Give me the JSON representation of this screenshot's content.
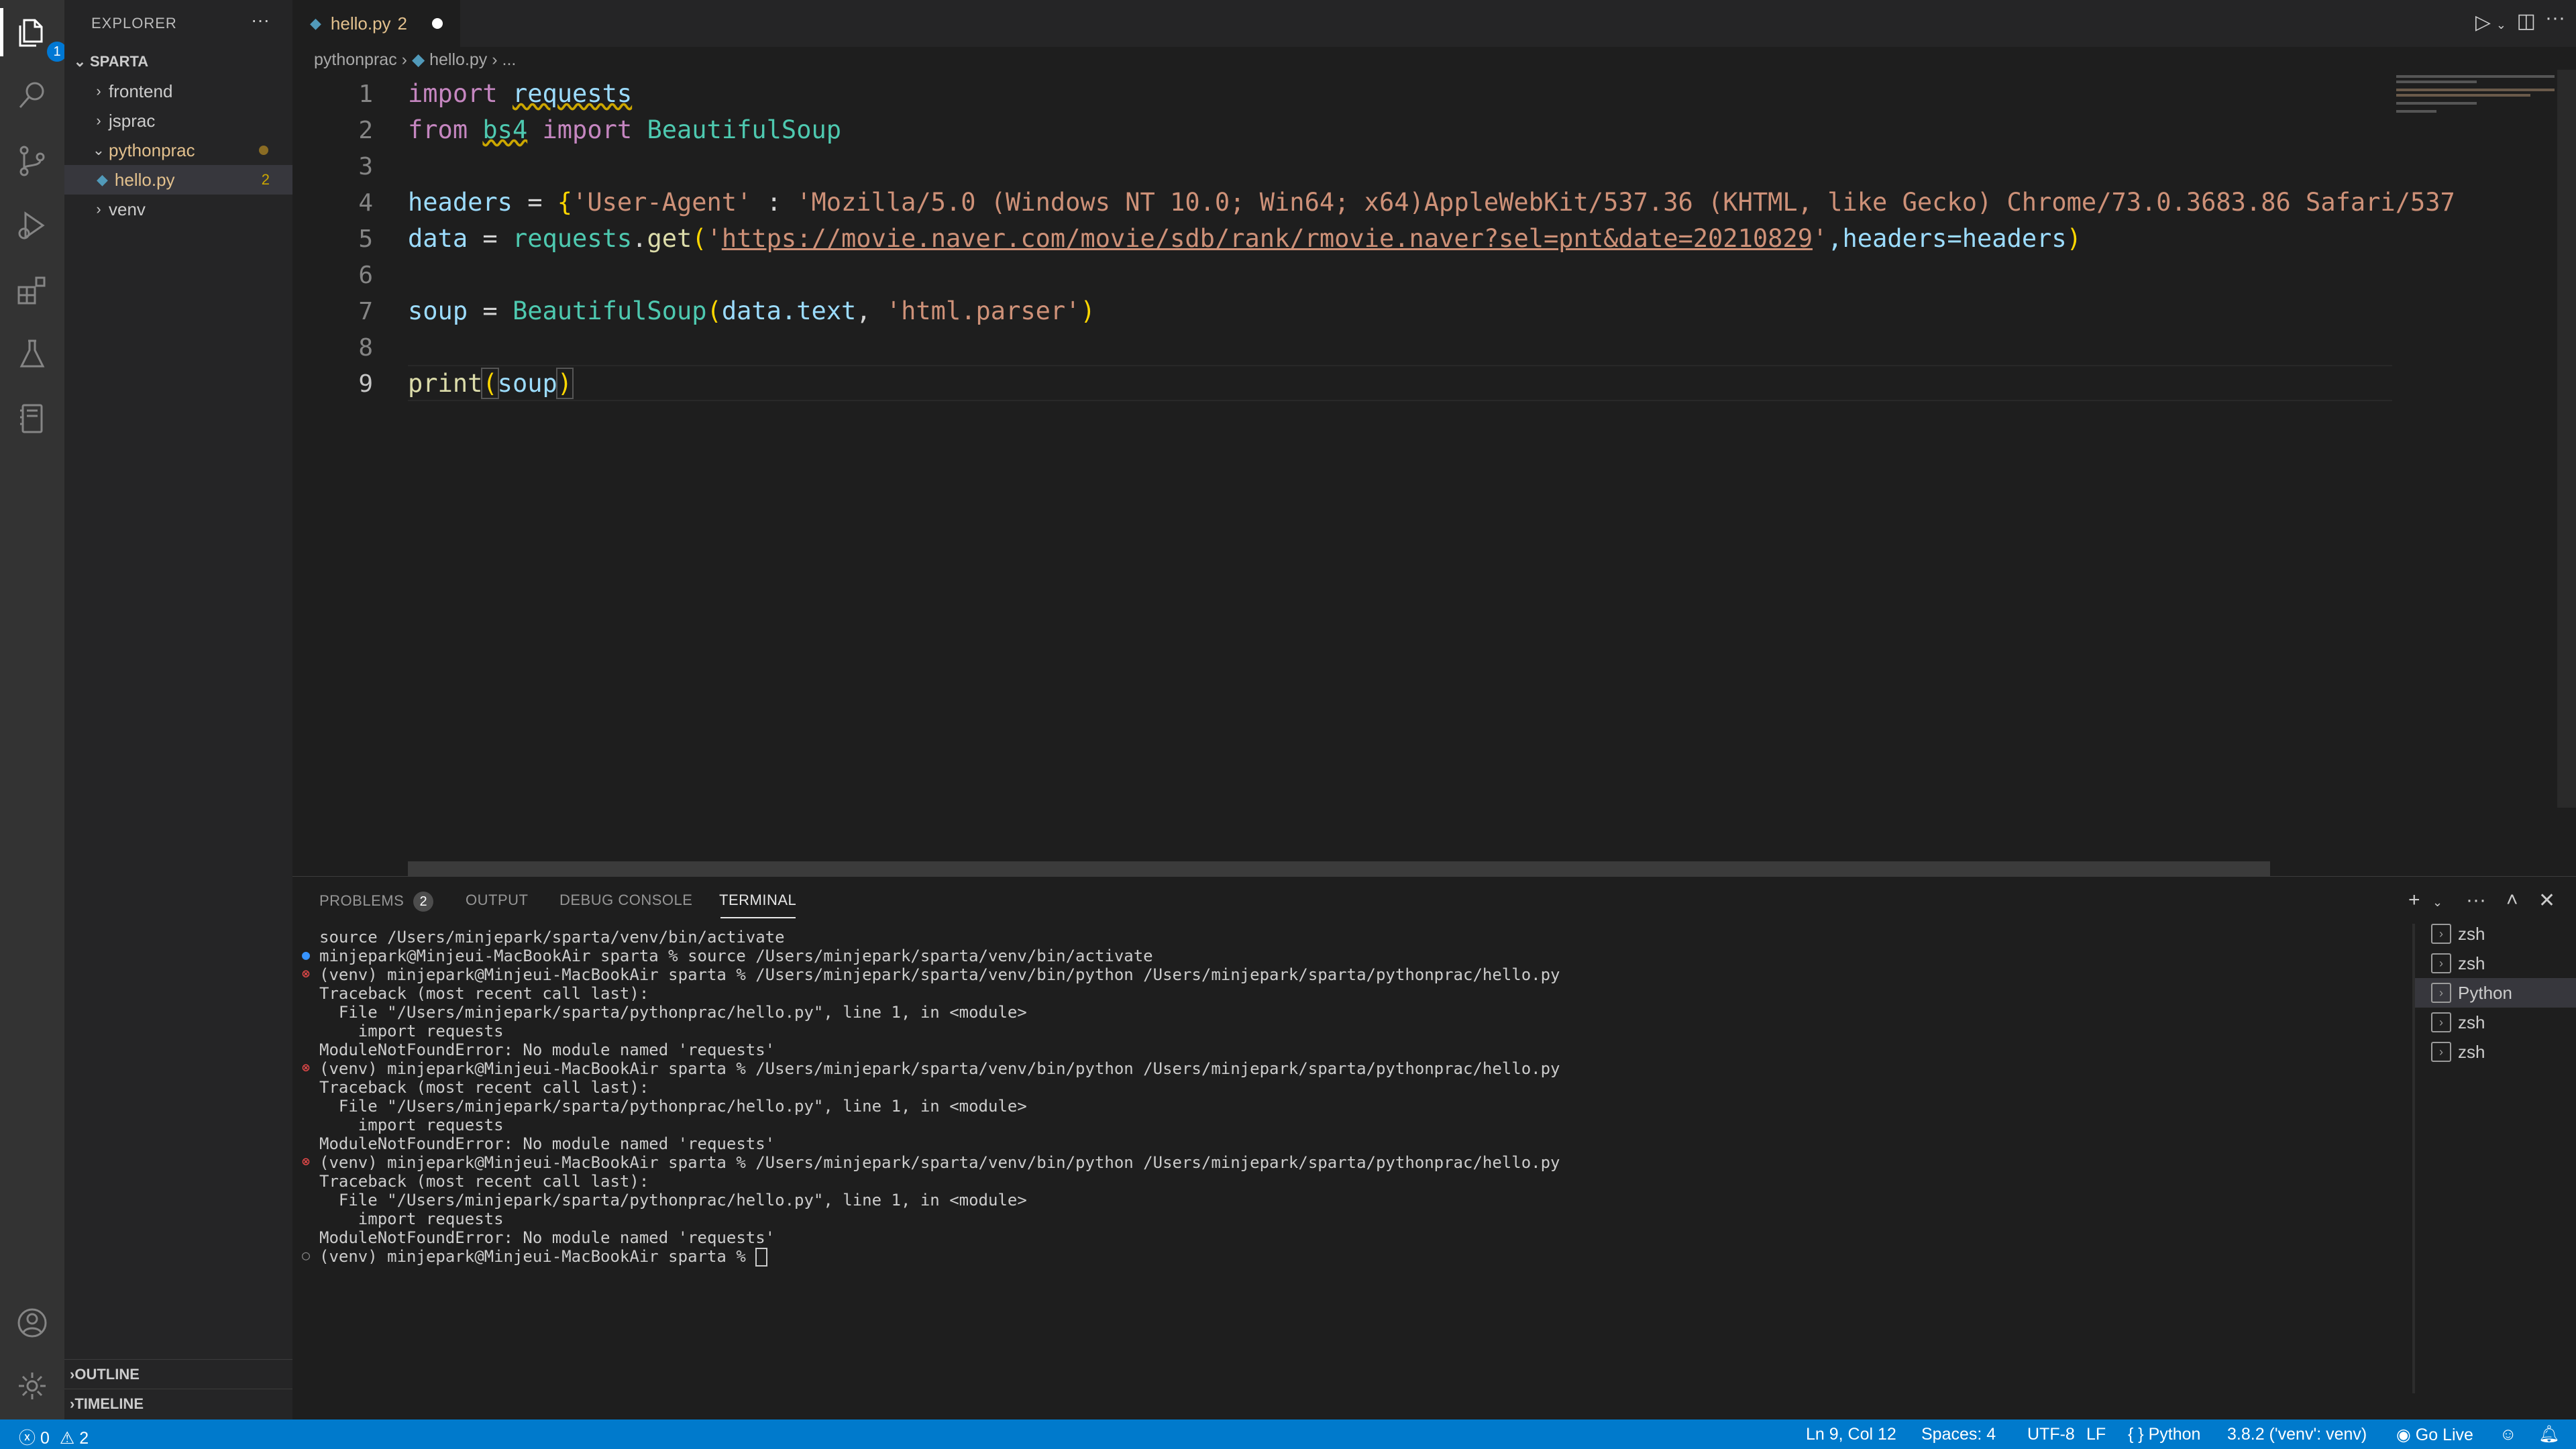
{
  "activity_bar": {
    "explorer_badge": "1",
    "icons": [
      "files-icon",
      "search-icon",
      "source-control-icon",
      "run-debug-icon",
      "extensions-icon",
      "testing-icon",
      "notebook-icon",
      "account-icon",
      "gear-icon"
    ]
  },
  "sidebar": {
    "title": "EXPLORER",
    "more": "···",
    "root": "SPARTA",
    "items": [
      {
        "label": "frontend",
        "type": "folder"
      },
      {
        "label": "jsprac",
        "type": "folder"
      },
      {
        "label": "pythonprac",
        "type": "folder-open"
      },
      {
        "label": "hello.py",
        "type": "file",
        "badge": "2"
      },
      {
        "label": "venv",
        "type": "folder"
      }
    ],
    "outline": "OUTLINE",
    "timeline": "TIMELINE"
  },
  "tab": {
    "label": "hello.py",
    "problems": "2"
  },
  "breadcrumb": {
    "folder": "pythonprac",
    "file": "hello.py",
    "more": "..."
  },
  "editor": {
    "line_numbers": [
      "1",
      "2",
      "3",
      "4",
      "5",
      "6",
      "7",
      "8",
      "9"
    ],
    "lines": {
      "l1": {
        "kw": "import",
        "mod": "requests"
      },
      "l2": {
        "kw1": "from",
        "mod": "bs4",
        "kw2": "import",
        "cls": "BeautifulSoup"
      },
      "l4": {
        "var": "headers",
        "eq": " = ",
        "brace": "{",
        "key": "'User-Agent'",
        "colon": " : ",
        "val": "'Mozilla/5.0 (Windows NT 10.0; Win64; x64)AppleWebKit/537.36 (KHTML, like Gecko) Chrome/73.0.3683.86 Safari/537"
      },
      "l5": {
        "var": "data",
        "eq": " = ",
        "obj": "requests",
        "dot": ".",
        "fn": "get",
        "open": "(",
        "q1": "'",
        "url": "https://movie.naver.com/movie/sdb/rank/rmovie.naver?sel=pnt&date=20210829",
        "q2": "'",
        "rest": ",headers=headers",
        "close": ")"
      },
      "l7": {
        "var": "soup",
        "eq": " = ",
        "cls": "BeautifulSoup",
        "open": "(",
        "arg": "data.text",
        "comma": ", ",
        "str": "'html.parser'",
        "close": ")"
      },
      "l9": {
        "fn": "print",
        "open": "(",
        "arg": "soup",
        "close": ")"
      }
    }
  },
  "panel": {
    "tabs": [
      "PROBLEMS",
      "OUTPUT",
      "DEBUG CONSOLE",
      "TERMINAL"
    ],
    "problems_count": "2",
    "terminal_lines": [
      "source /Users/minjepark/sparta/venv/bin/activate",
      "minjepark@Minjeui-MacBookAir sparta % source /Users/minjepark/sparta/venv/bin/activate",
      "(venv) minjepark@Minjeui-MacBookAir sparta % /Users/minjepark/sparta/venv/bin/python /Users/minjepark/sparta/pythonprac/hello.py",
      "Traceback (most recent call last):",
      "  File \"/Users/minjepark/sparta/pythonprac/hello.py\", line 1, in <module>",
      "    import requests",
      "ModuleNotFoundError: No module named 'requests'",
      "(venv) minjepark@Minjeui-MacBookAir sparta % /Users/minjepark/sparta/venv/bin/python /Users/minjepark/sparta/pythonprac/hello.py",
      "Traceback (most recent call last):",
      "  File \"/Users/minjepark/sparta/pythonprac/hello.py\", line 1, in <module>",
      "    import requests",
      "ModuleNotFoundError: No module named 'requests'",
      "(venv) minjepark@Minjeui-MacBookAir sparta % /Users/minjepark/sparta/venv/bin/python /Users/minjepark/sparta/pythonprac/hello.py",
      "Traceback (most recent call last):",
      "  File \"/Users/minjepark/sparta/pythonprac/hello.py\", line 1, in <module>",
      "    import requests",
      "ModuleNotFoundError: No module named 'requests'",
      "(venv) minjepark@Minjeui-MacBookAir sparta % "
    ],
    "terminals": [
      "zsh",
      "zsh",
      "Python",
      "zsh",
      "zsh"
    ]
  },
  "statusbar": {
    "errors": "0",
    "warnings": "2",
    "position": "Ln 9, Col 12",
    "spaces": "Spaces: 4",
    "encoding": "UTF-8",
    "eol": "LF",
    "language": "Python",
    "interpreter": "3.8.2 ('venv': venv)",
    "golive": "Go Live"
  },
  "colors": {
    "accent": "#007acc",
    "error": "#f14c4c",
    "warning": "#cca700",
    "modified": "#e2c08d"
  }
}
